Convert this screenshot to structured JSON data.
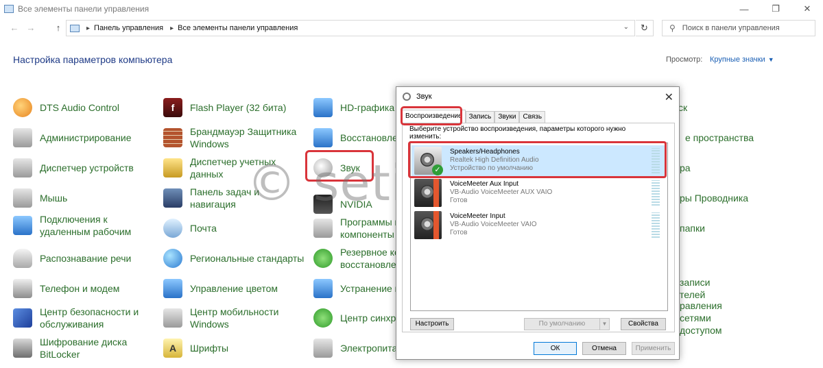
{
  "window": {
    "title": "Все элементы панели управления",
    "minimize": "—",
    "restore": "❐",
    "close": "✕"
  },
  "nav": {
    "back": "←",
    "forward": "→",
    "up": "↑",
    "breadcrumb": [
      "Панель управления",
      "Все элементы панели управления"
    ],
    "refresh": "↻",
    "search_placeholder": "Поиск в панели управления"
  },
  "header": {
    "title": "Настройка параметров компьютера",
    "view_label": "Просмотр:",
    "view_value": "Крупные значки"
  },
  "items": {
    "col1": [
      {
        "label": "DTS Audio Control"
      },
      {
        "label": "Администрирование"
      },
      {
        "label": "Диспетчер устройств"
      },
      {
        "label": "Мышь"
      },
      {
        "label": "Подключения к удаленным рабочим"
      },
      {
        "label": "Распознавание речи"
      },
      {
        "label": "Телефон и модем"
      },
      {
        "label": "Центр безопасности и обслуживания"
      },
      {
        "label": "Шифрование диска BitLocker"
      }
    ],
    "col2": [
      {
        "label": "Flash Player (32 бита)"
      },
      {
        "label": "Брандмауэр Защитника Windows"
      },
      {
        "label": "Диспетчер учетных данных"
      },
      {
        "label": "Панель задач и навигация"
      },
      {
        "label": "Почта"
      },
      {
        "label": "Региональные стандарты"
      },
      {
        "label": "Управление цветом"
      },
      {
        "label": "Центр мобильности Windows"
      },
      {
        "label": "Шрифты"
      }
    ],
    "col3": [
      {
        "label": "HD-графика"
      },
      {
        "label": "Восстановлен"
      },
      {
        "label": "Звук"
      },
      {
        "label": "NVIDIA"
      },
      {
        "label": "Программы и компоненты"
      },
      {
        "label": "Резервное ко восстановлен"
      },
      {
        "label": "Устранение н"
      },
      {
        "label": "Центр синхро"
      },
      {
        "label": "Электропита"
      }
    ],
    "col4": [
      {
        "label": "ск"
      },
      {
        "label": "е пространства"
      },
      {
        "label": "ра"
      },
      {
        "label": "ры Проводника"
      },
      {
        "label": "папки"
      },
      {
        "label": "записи телей"
      },
      {
        "label": "равления сетями доступом"
      }
    ]
  },
  "watermark": "© setivik.ru",
  "dialog": {
    "title": "Звук",
    "close": "✕",
    "tabs": [
      "Воспроизведение",
      "Запись",
      "Звуки",
      "Связь"
    ],
    "instruction": "Выберите устройство воспроизведения, параметры которого нужно изменить:",
    "devices": [
      {
        "name": "Speakers/Headphones",
        "desc": "Realtek High Definition Audio",
        "state": "Устройство по умолчанию"
      },
      {
        "name": "VoiceMeeter Aux Input",
        "desc": "VB-Audio VoiceMeeter AUX VAIO",
        "state": "Готов"
      },
      {
        "name": "VoiceMeeter Input",
        "desc": "VB-Audio VoiceMeeter VAIO",
        "state": "Готов"
      }
    ],
    "configure_btn": "Настроить",
    "default_btn": "По умолчанию",
    "properties_btn": "Свойства",
    "ok_btn": "ОК",
    "cancel_btn": "Отмена",
    "apply_btn": "Применить"
  },
  "colors": {
    "link_green": "#2b6e2b",
    "title_blue": "#1e3a86",
    "highlight_red": "#d9343a",
    "selected_bg": "#cce8ff"
  }
}
